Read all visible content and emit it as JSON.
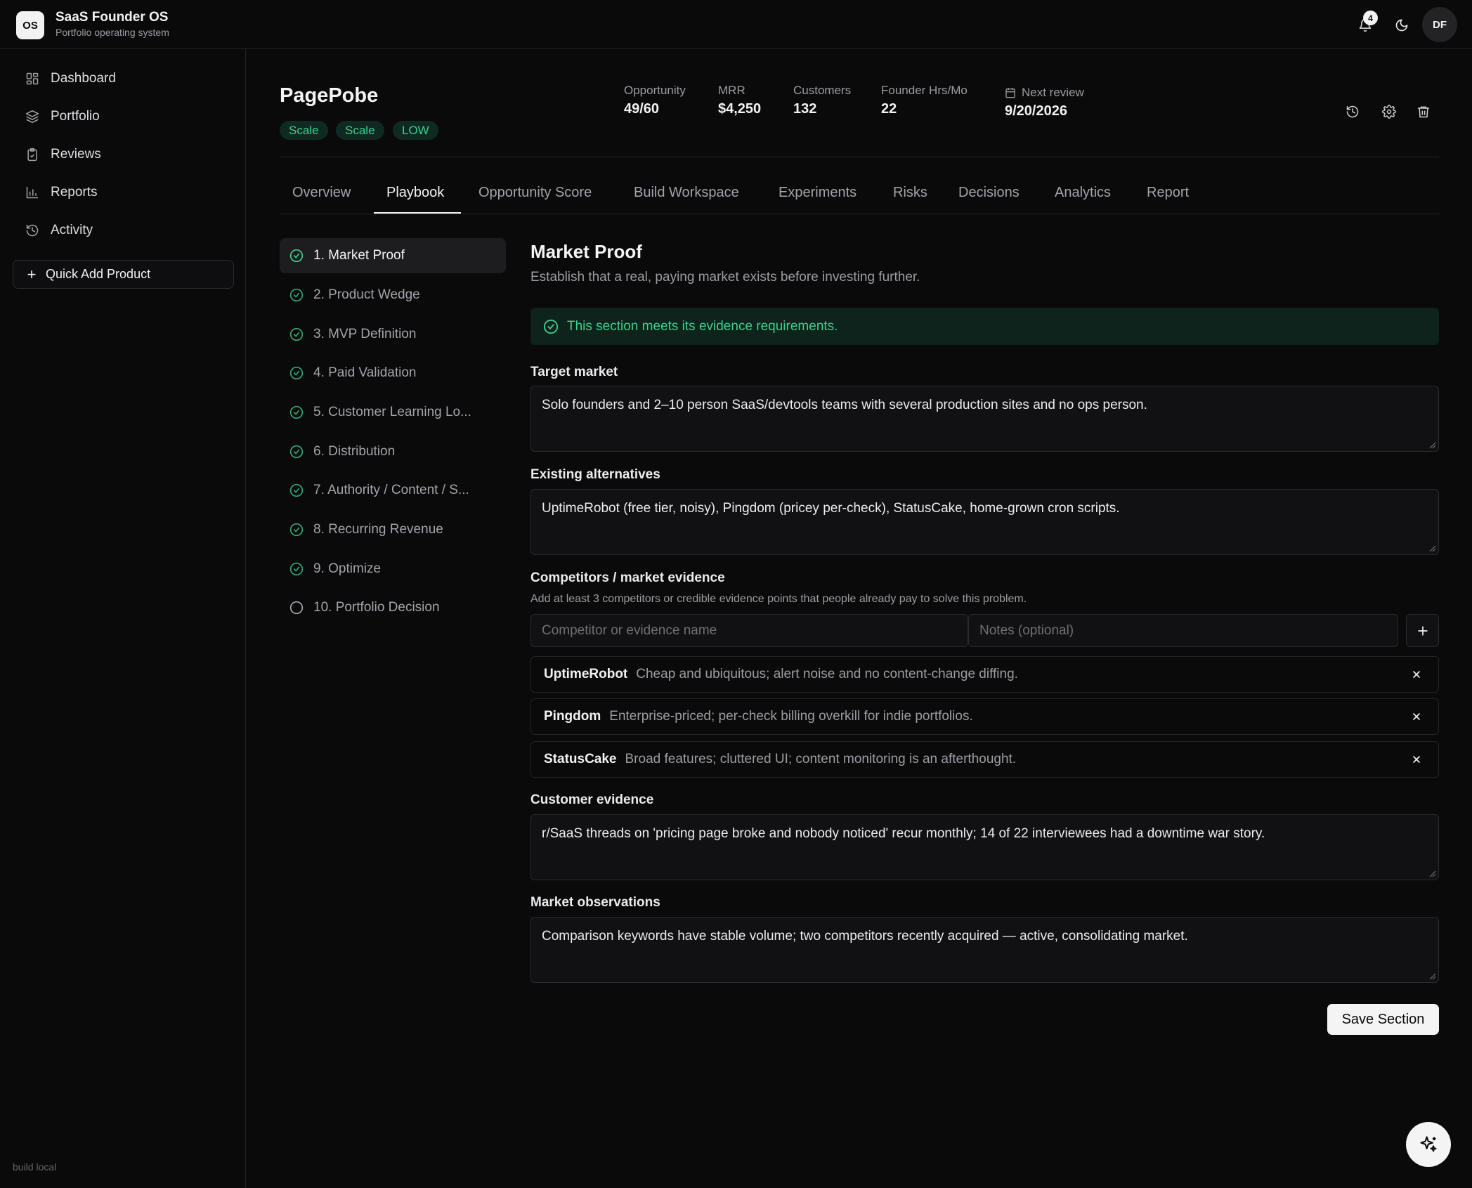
{
  "app": {
    "logo": "OS",
    "title": "SaaS Founder OS",
    "subtitle": "Portfolio operating system",
    "notification_count": "4",
    "avatar_initials": "DF"
  },
  "sidebar": {
    "items": [
      {
        "label": "Dashboard",
        "icon": "grid-icon"
      },
      {
        "label": "Portfolio",
        "icon": "layers-icon"
      },
      {
        "label": "Reviews",
        "icon": "clipboard-check-icon"
      },
      {
        "label": "Reports",
        "icon": "bar-chart-icon"
      },
      {
        "label": "Activity",
        "icon": "history-icon"
      }
    ],
    "quick_add_label": "Quick Add Product",
    "build_label": "build local"
  },
  "product": {
    "name": "PagePobe",
    "tags": [
      "Scale",
      "Scale",
      "LOW"
    ],
    "metrics": {
      "opportunity_label": "Opportunity",
      "opportunity_value": "49/60",
      "mrr_label": "MRR",
      "mrr_value": "$4,250",
      "customers_label": "Customers",
      "customers_value": "132",
      "hours_label": "Founder Hrs/Mo",
      "hours_value": "22",
      "review_label": "Next review",
      "review_value": "9/20/2026"
    }
  },
  "tabs": [
    "Overview",
    "Playbook",
    "Opportunity Score",
    "Build Workspace",
    "Experiments",
    "Risks",
    "Decisions",
    "Analytics",
    "Report"
  ],
  "active_tab": "Playbook",
  "steps": [
    {
      "label": "1. Market Proof",
      "done": true
    },
    {
      "label": "2. Product Wedge",
      "done": true
    },
    {
      "label": "3. MVP Definition",
      "done": true
    },
    {
      "label": "4. Paid Validation",
      "done": true
    },
    {
      "label": "5. Customer Learning Lo...",
      "done": true
    },
    {
      "label": "6. Distribution",
      "done": true
    },
    {
      "label": "7. Authority / Content / S...",
      "done": true
    },
    {
      "label": "8. Recurring Revenue",
      "done": true
    },
    {
      "label": "9. Optimize",
      "done": true
    },
    {
      "label": "10. Portfolio Decision",
      "done": false
    }
  ],
  "section": {
    "title": "Market Proof",
    "description": "Establish that a real, paying market exists before investing further.",
    "status_message": "This section meets its evidence requirements.",
    "target_market_label": "Target market",
    "target_market_value": "Solo founders and 2–10 person SaaS/devtools teams with several production sites and no ops person.",
    "alternatives_label": "Existing alternatives",
    "alternatives_value": "UptimeRobot (free tier, noisy), Pingdom (pricey per-check), StatusCake, home-grown cron scripts.",
    "competitors_label": "Competitors / market evidence",
    "competitors_help": "Add at least 3 competitors or credible evidence points that people already pay to solve this problem.",
    "competitor_placeholder": "Competitor or evidence name",
    "notes_placeholder": "Notes (optional)",
    "competitors": [
      {
        "name": "UptimeRobot",
        "note": "Cheap and ubiquitous; alert noise and no content-change diffing."
      },
      {
        "name": "Pingdom",
        "note": "Enterprise-priced; per-check billing overkill for indie portfolios."
      },
      {
        "name": "StatusCake",
        "note": "Broad features; cluttered UI; content monitoring is an afterthought."
      }
    ],
    "customer_evidence_label": "Customer evidence",
    "customer_evidence_value": "r/SaaS threads on 'pricing page broke and nobody noticed' recur monthly; 14 of 22 interviewees had a downtime war story.",
    "observations_label": "Market observations",
    "observations_value": "Comparison keywords have stable volume; two competitors recently acquired — active, consolidating market.",
    "save_label": "Save Section"
  },
  "colors": {
    "accent_green": "#3ecf8e",
    "background": "#0a0a0b"
  }
}
